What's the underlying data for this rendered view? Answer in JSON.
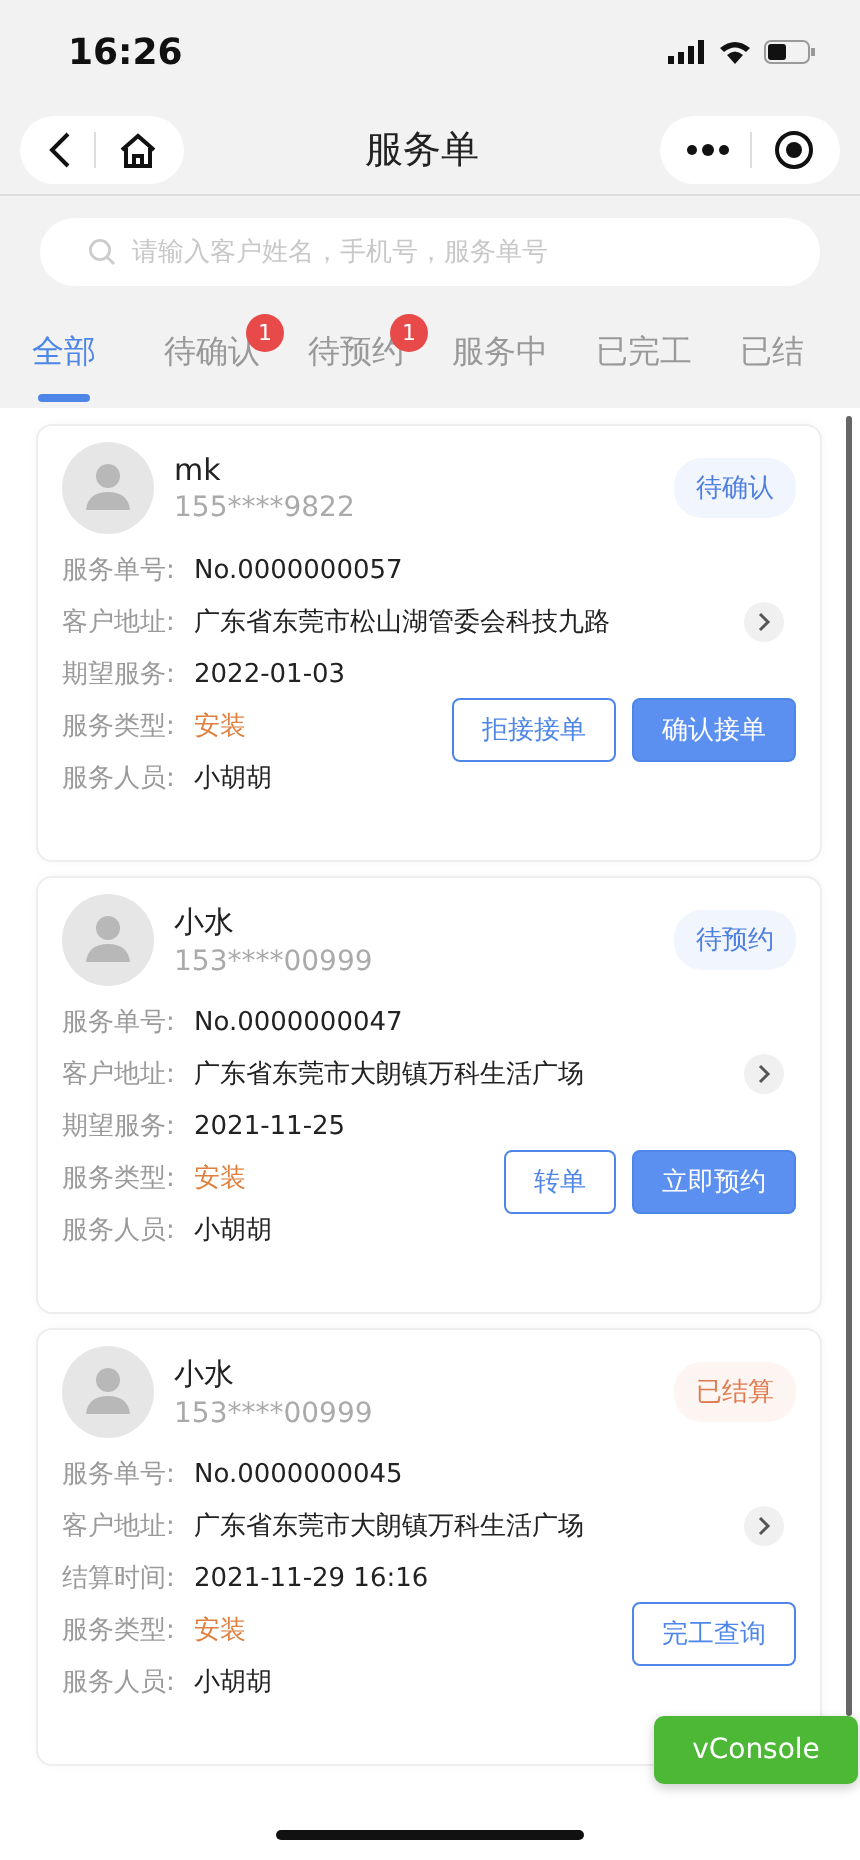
{
  "status_bar": {
    "time": "16:26"
  },
  "nav": {
    "title": "服务单"
  },
  "search": {
    "placeholder": "请输入客户姓名，手机号，服务单号"
  },
  "tabs": [
    {
      "label": "全部",
      "selected": true
    },
    {
      "label": "待确认",
      "selected": false,
      "badge": "1"
    },
    {
      "label": "待预约",
      "selected": false,
      "badge": "1"
    },
    {
      "label": "服务中",
      "selected": false
    },
    {
      "label": "已完工",
      "selected": false
    },
    {
      "label": "已结",
      "selected": false
    }
  ],
  "orders": [
    {
      "name": "mk",
      "phone": "155****9822",
      "status": {
        "label": "待确认",
        "color": "#4e7fe0"
      },
      "fields": [
        {
          "label": "服务单号:",
          "value": "No.0000000057",
          "kind": "plain"
        },
        {
          "label": "客户地址:",
          "value": "广东省东莞市松山湖管委会科技九路",
          "kind": "link"
        },
        {
          "label": "期望服务:",
          "value": "2022-01-03",
          "kind": "plain"
        },
        {
          "label": "服务类型:",
          "value": "安装",
          "kind": "accent"
        },
        {
          "label": "服务人员:",
          "value": "小胡胡",
          "kind": "plain"
        }
      ],
      "buttons": [
        {
          "label": "拒接接单",
          "kind": "outline"
        },
        {
          "label": "确认接单",
          "kind": "primary"
        }
      ]
    },
    {
      "name": "小水",
      "phone": "153****00999",
      "status": {
        "label": "待预约",
        "color": "#4e7fe0"
      },
      "fields": [
        {
          "label": "服务单号:",
          "value": "No.0000000047",
          "kind": "plain"
        },
        {
          "label": "客户地址:",
          "value": "广东省东莞市大朗镇万科生活广场",
          "kind": "link"
        },
        {
          "label": "期望服务:",
          "value": "2021-11-25",
          "kind": "plain"
        },
        {
          "label": "服务类型:",
          "value": "安装",
          "kind": "accent"
        },
        {
          "label": "服务人员:",
          "value": "小胡胡",
          "kind": "plain"
        }
      ],
      "buttons": [
        {
          "label": "转单",
          "kind": "outline"
        },
        {
          "label": "立即预约",
          "kind": "primary"
        }
      ]
    },
    {
      "name": "小水",
      "phone": "153****00999",
      "status": {
        "label": "已结算",
        "color": "#e07a4e"
      },
      "fields": [
        {
          "label": "服务单号:",
          "value": "No.0000000045",
          "kind": "plain"
        },
        {
          "label": "客户地址:",
          "value": "广东省东莞市大朗镇万科生活广场",
          "kind": "link"
        },
        {
          "label": "结算时间:",
          "value": "2021-11-29 16:16",
          "kind": "plain"
        },
        {
          "label": "服务类型:",
          "value": "安装",
          "kind": "accent"
        },
        {
          "label": "服务人员:",
          "value": "小胡胡",
          "kind": "plain"
        }
      ],
      "buttons": [
        {
          "label": "完工查询",
          "kind": "outline"
        }
      ]
    }
  ],
  "floating_button": {
    "label": "vConsole"
  }
}
